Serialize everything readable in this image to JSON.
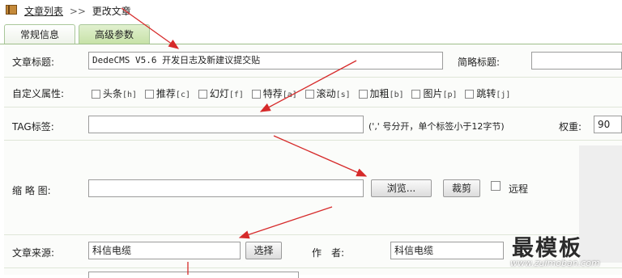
{
  "breadcrumb": {
    "home": "文章列表",
    "sep": ">>",
    "current": "更改文章",
    "icon": "book-icon"
  },
  "tabs": [
    {
      "label": "常规信息"
    },
    {
      "label": "高级参数"
    }
  ],
  "form": {
    "title_label": "文章标题:",
    "title_value": "DedeCMS V5.6 开发日志及新建议提交贴",
    "short_title_label": "简略标题:",
    "attr_label": "自定义属性:",
    "attrs": [
      {
        "name": "头条",
        "code": "[h]"
      },
      {
        "name": "推荐",
        "code": "[c]"
      },
      {
        "name": "幻灯",
        "code": "[f]"
      },
      {
        "name": "特荐",
        "code": "[a]"
      },
      {
        "name": "滚动",
        "code": "[s]"
      },
      {
        "name": "加粗",
        "code": "[b]"
      },
      {
        "name": "图片",
        "code": "[p]"
      },
      {
        "name": "跳转",
        "code": "[j]"
      }
    ],
    "tag_label": "TAG标签:",
    "tag_hint": "(',' 号分开，单个标签小于12字节)",
    "weight_label": "权重:",
    "weight_value": "90",
    "thumb_label": "缩 略 图:",
    "browse_button": "浏览...",
    "crop_button": "裁剪",
    "remote_label": "远程",
    "source_label": "文章来源:",
    "source_value": "科信电缆",
    "select_button": "选择",
    "author_label": "作　者:",
    "author_value": "科信电缆"
  },
  "watermark": {
    "text": "最模板",
    "url": "www.zuimoban.com"
  },
  "colors": {
    "arrow": "#d62a2a",
    "tab_active": "#c7e2a8",
    "row_border": "#dfe6d8"
  }
}
